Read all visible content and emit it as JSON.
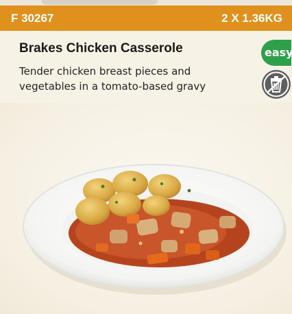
{
  "header": {
    "product_code": "F 30267",
    "pack_size": "2 X 1.36KG"
  },
  "product": {
    "name": "Brakes Chicken Casserole",
    "description": "Tender chicken breast pieces and vegetables in a tomato-based gravy"
  },
  "badges": {
    "easy_label": "easy",
    "easy_color": "#2ea04a",
    "bin_icon": "no-waste-bin-icon",
    "bin_color": "#5f5f5f"
  },
  "colors": {
    "header_bg": "#e0901c",
    "page_bg": "#f7f2e6"
  }
}
